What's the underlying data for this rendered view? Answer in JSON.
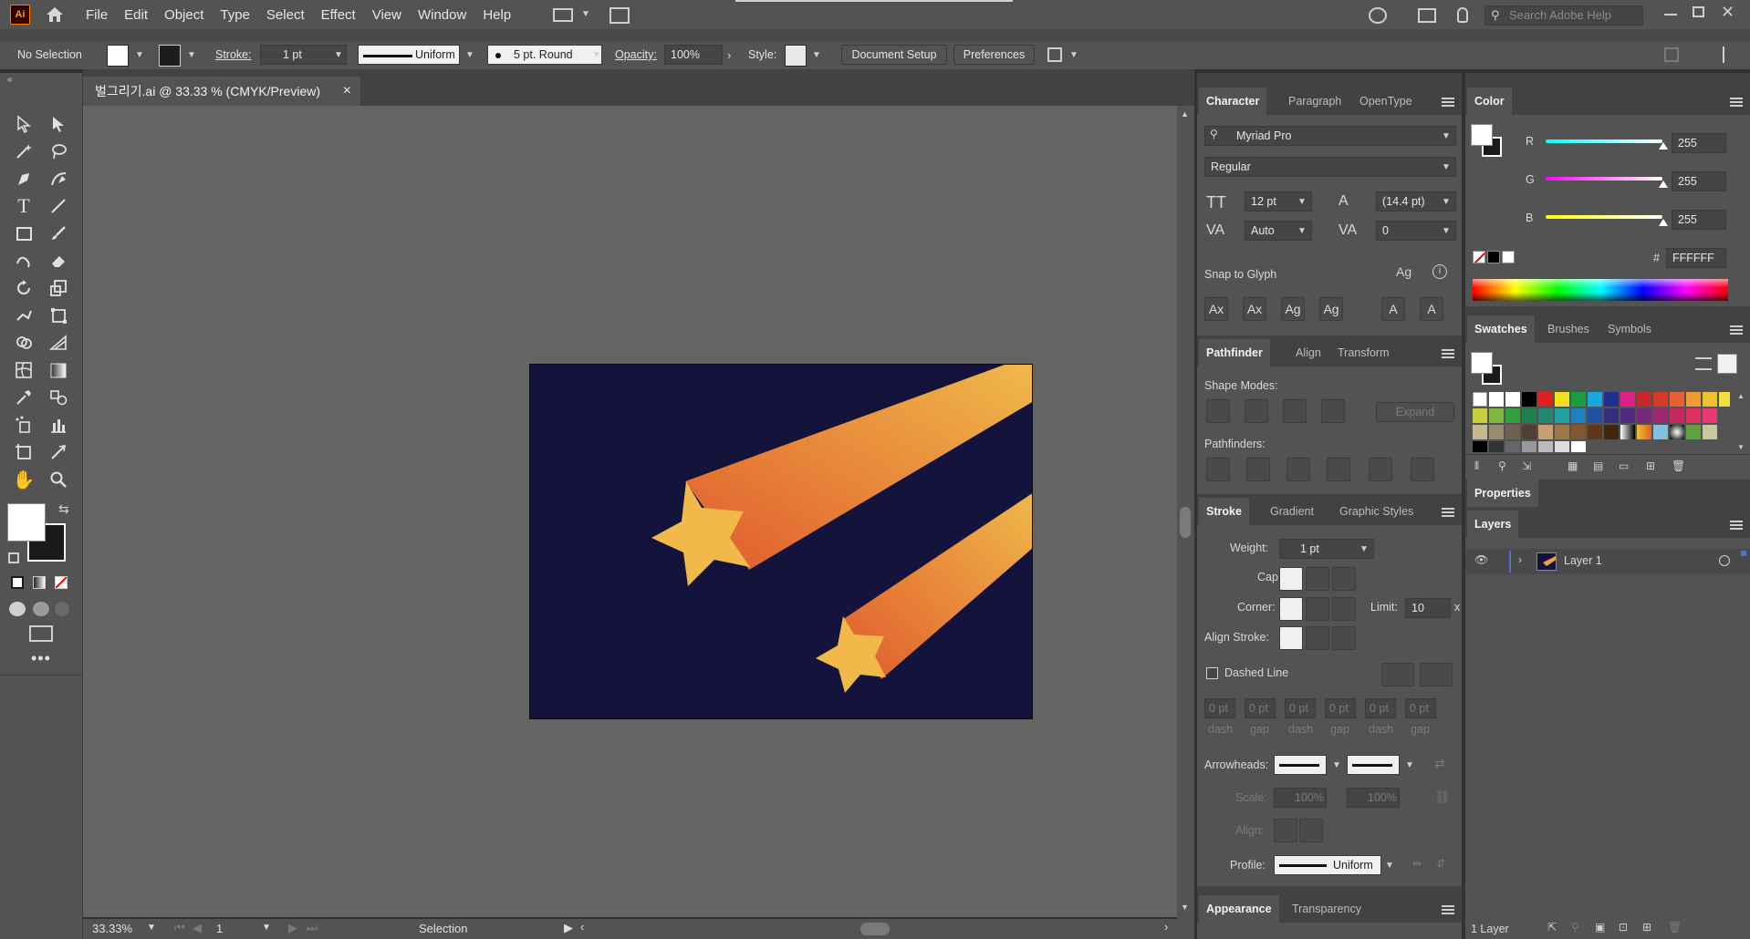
{
  "app": {
    "logo": "Ai",
    "search_placeholder": "Search Adobe Help"
  },
  "menus": [
    "File",
    "Edit",
    "Object",
    "Type",
    "Select",
    "Effect",
    "View",
    "Window",
    "Help"
  ],
  "control": {
    "selection": "No Selection",
    "stroke_label": "Stroke:",
    "stroke_weight": "1 pt",
    "stroke_profile": "Uniform",
    "brush": "5 pt. Round",
    "opacity_label": "Opacity:",
    "opacity": "100%",
    "style_label": "Style:",
    "document_setup": "Document Setup",
    "preferences": "Preferences"
  },
  "document": {
    "tab_title": "벌그리기.ai @ 33.33 % (CMYK/Preview)",
    "close": "×"
  },
  "status": {
    "zoom": "33.33%",
    "artboard": "1",
    "tool": "Selection"
  },
  "character": {
    "tabs": [
      "Character",
      "Paragraph",
      "OpenType"
    ],
    "font_family": "Myriad Pro",
    "font_style": "Regular",
    "font_size": "12 pt",
    "leading": "(14.4 pt)",
    "kerning": "Auto",
    "tracking": "0",
    "snap_to_glyph": "Snap to Glyph"
  },
  "color": {
    "tab": "Color",
    "r_label": "R",
    "g_label": "G",
    "b_label": "B",
    "r": "255",
    "g": "255",
    "b": "255",
    "hex_label": "#",
    "hex": "FFFFFF"
  },
  "swatches": {
    "tabs": [
      "Swatches",
      "Brushes",
      "Symbols"
    ]
  },
  "pathfinder": {
    "tabs": [
      "Pathfinder",
      "Align",
      "Transform"
    ],
    "shape_modes": "Shape Modes:",
    "expand": "Expand",
    "pathfinders": "Pathfinders:"
  },
  "properties": {
    "tab": "Properties"
  },
  "layers": {
    "tab": "Layers",
    "layer_name": "Layer 1",
    "count": "1 Layer"
  },
  "stroke": {
    "tabs": [
      "Stroke",
      "Gradient",
      "Graphic Styles"
    ],
    "weight_label": "Weight:",
    "weight": "1 pt",
    "cap_label": "Cap:",
    "corner_label": "Corner:",
    "limit_label": "Limit:",
    "limit": "10",
    "limit_x": "x",
    "align_label": "Align Stroke:",
    "dashed_line": "Dashed Line",
    "dash_fields": [
      "0 pt",
      "0 pt",
      "0 pt",
      "0 pt",
      "0 pt",
      "0 pt"
    ],
    "dash_labels": [
      "dash",
      "gap",
      "dash",
      "gap",
      "dash",
      "gap"
    ],
    "arrowheads_label": "Arrowheads:",
    "scale_label": "Scale:",
    "scale1": "100%",
    "scale2": "100%",
    "align2_label": "Align:",
    "profile_label": "Profile:",
    "profile": "Uniform"
  },
  "appearance": {
    "tabs": [
      "Appearance",
      "Transparency"
    ]
  },
  "colors": {
    "ui_dark": "#535353",
    "canvas": "#646464",
    "artboard": "#13133b",
    "star": "#f0b94a",
    "trail_start": "#e05a2b",
    "trail_end": "#f0b94a",
    "layer_accent": "#4a78c8"
  }
}
